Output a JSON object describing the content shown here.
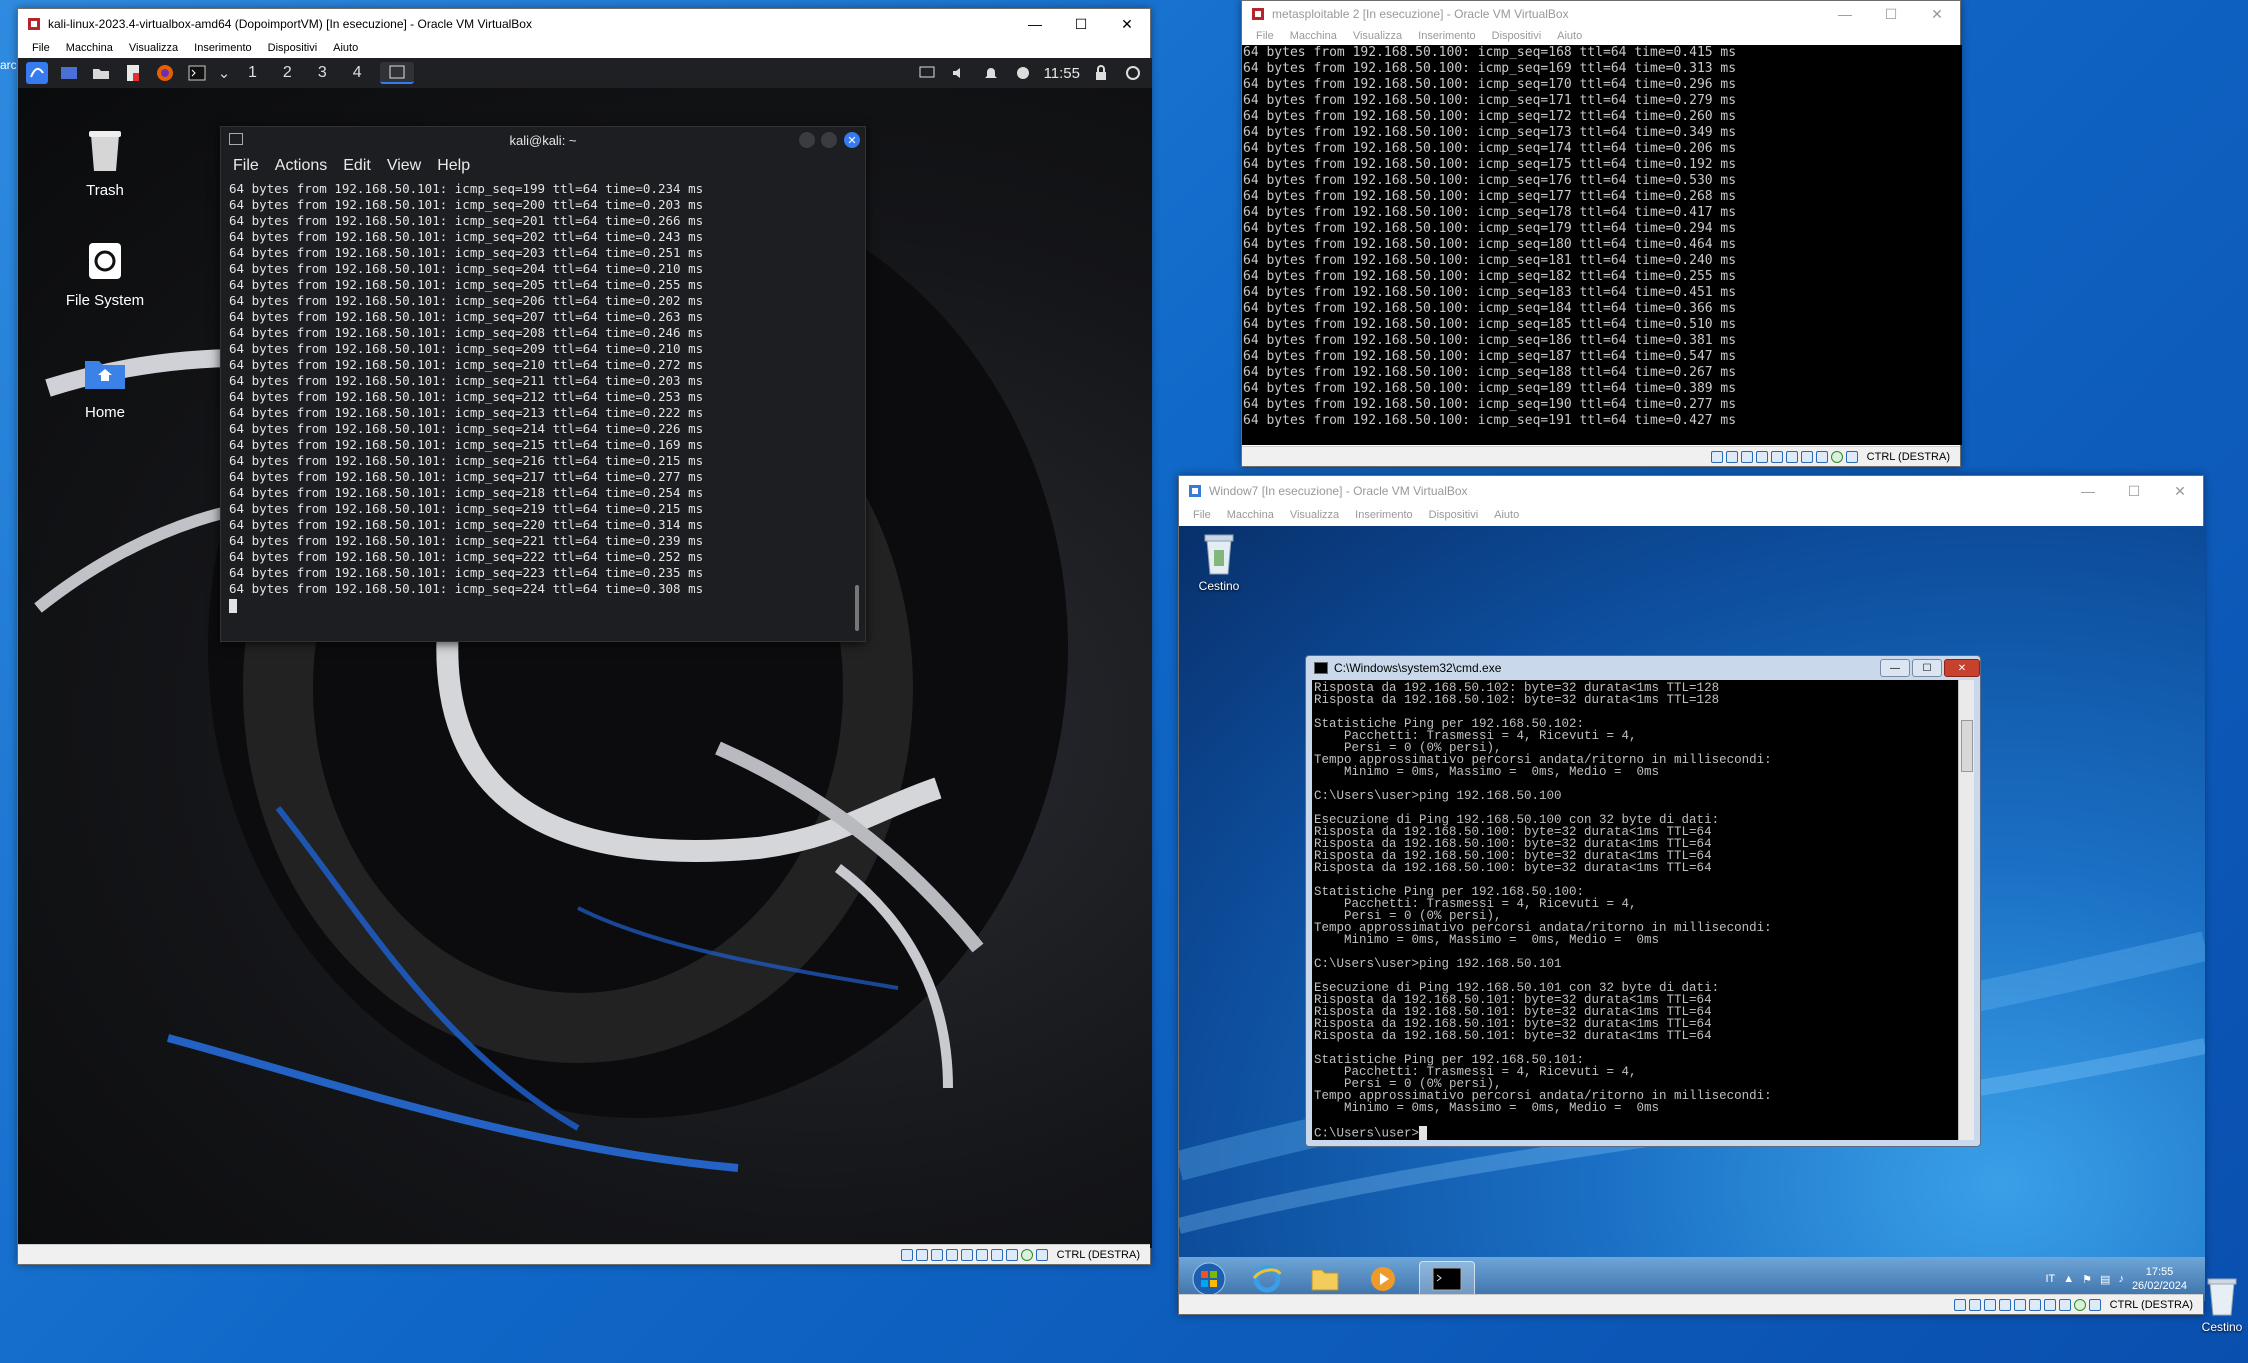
{
  "kali_window": {
    "title": "kali-linux-2023.4-virtualbox-amd64 (DopoimportVM) [In esecuzione] - Oracle VM VirtualBox",
    "menu": [
      "File",
      "Macchina",
      "Visualizza",
      "Inserimento",
      "Dispositivi",
      "Aiuto"
    ],
    "status_host_key": "CTRL (DESTRA)"
  },
  "kali_panel": {
    "workspaces": [
      "1",
      "2",
      "3",
      "4"
    ],
    "clock": "11:55"
  },
  "kali_desktop_icons": [
    "Trash",
    "File System",
    "Home"
  ],
  "terminal": {
    "title": "kali@kali: ~",
    "menu": [
      "File",
      "Actions",
      "Edit",
      "View",
      "Help"
    ],
    "lines": [
      "64 bytes from 192.168.50.101: icmp_seq=199 ttl=64 time=0.234 ms",
      "64 bytes from 192.168.50.101: icmp_seq=200 ttl=64 time=0.203 ms",
      "64 bytes from 192.168.50.101: icmp_seq=201 ttl=64 time=0.266 ms",
      "64 bytes from 192.168.50.101: icmp_seq=202 ttl=64 time=0.243 ms",
      "64 bytes from 192.168.50.101: icmp_seq=203 ttl=64 time=0.251 ms",
      "64 bytes from 192.168.50.101: icmp_seq=204 ttl=64 time=0.210 ms",
      "64 bytes from 192.168.50.101: icmp_seq=205 ttl=64 time=0.255 ms",
      "64 bytes from 192.168.50.101: icmp_seq=206 ttl=64 time=0.202 ms",
      "64 bytes from 192.168.50.101: icmp_seq=207 ttl=64 time=0.263 ms",
      "64 bytes from 192.168.50.101: icmp_seq=208 ttl=64 time=0.246 ms",
      "64 bytes from 192.168.50.101: icmp_seq=209 ttl=64 time=0.210 ms",
      "64 bytes from 192.168.50.101: icmp_seq=210 ttl=64 time=0.272 ms",
      "64 bytes from 192.168.50.101: icmp_seq=211 ttl=64 time=0.203 ms",
      "64 bytes from 192.168.50.101: icmp_seq=212 ttl=64 time=0.253 ms",
      "64 bytes from 192.168.50.101: icmp_seq=213 ttl=64 time=0.222 ms",
      "64 bytes from 192.168.50.101: icmp_seq=214 ttl=64 time=0.226 ms",
      "64 bytes from 192.168.50.101: icmp_seq=215 ttl=64 time=0.169 ms",
      "64 bytes from 192.168.50.101: icmp_seq=216 ttl=64 time=0.215 ms",
      "64 bytes from 192.168.50.101: icmp_seq=217 ttl=64 time=0.277 ms",
      "64 bytes from 192.168.50.101: icmp_seq=218 ttl=64 time=0.254 ms",
      "64 bytes from 192.168.50.101: icmp_seq=219 ttl=64 time=0.215 ms",
      "64 bytes from 192.168.50.101: icmp_seq=220 ttl=64 time=0.314 ms",
      "64 bytes from 192.168.50.101: icmp_seq=221 ttl=64 time=0.239 ms",
      "64 bytes from 192.168.50.101: icmp_seq=222 ttl=64 time=0.252 ms",
      "64 bytes from 192.168.50.101: icmp_seq=223 ttl=64 time=0.235 ms",
      "64 bytes from 192.168.50.101: icmp_seq=224 ttl=64 time=0.308 ms"
    ]
  },
  "meta_window": {
    "title": "metasploitable 2 [In esecuzione] - Oracle VM VirtualBox",
    "menu": [
      "File",
      "Macchina",
      "Visualizza",
      "Inserimento",
      "Dispositivi",
      "Aiuto"
    ],
    "status_host_key": "CTRL (DESTRA)",
    "lines": [
      "64 bytes from 192.168.50.100: icmp_seq=168 ttl=64 time=0.415 ms",
      "64 bytes from 192.168.50.100: icmp_seq=169 ttl=64 time=0.313 ms",
      "64 bytes from 192.168.50.100: icmp_seq=170 ttl=64 time=0.296 ms",
      "64 bytes from 192.168.50.100: icmp_seq=171 ttl=64 time=0.279 ms",
      "64 bytes from 192.168.50.100: icmp_seq=172 ttl=64 time=0.260 ms",
      "64 bytes from 192.168.50.100: icmp_seq=173 ttl=64 time=0.349 ms",
      "64 bytes from 192.168.50.100: icmp_seq=174 ttl=64 time=0.206 ms",
      "64 bytes from 192.168.50.100: icmp_seq=175 ttl=64 time=0.192 ms",
      "64 bytes from 192.168.50.100: icmp_seq=176 ttl=64 time=0.530 ms",
      "64 bytes from 192.168.50.100: icmp_seq=177 ttl=64 time=0.268 ms",
      "64 bytes from 192.168.50.100: icmp_seq=178 ttl=64 time=0.417 ms",
      "64 bytes from 192.168.50.100: icmp_seq=179 ttl=64 time=0.294 ms",
      "64 bytes from 192.168.50.100: icmp_seq=180 ttl=64 time=0.464 ms",
      "64 bytes from 192.168.50.100: icmp_seq=181 ttl=64 time=0.240 ms",
      "64 bytes from 192.168.50.100: icmp_seq=182 ttl=64 time=0.255 ms",
      "64 bytes from 192.168.50.100: icmp_seq=183 ttl=64 time=0.451 ms",
      "64 bytes from 192.168.50.100: icmp_seq=184 ttl=64 time=0.366 ms",
      "64 bytes from 192.168.50.100: icmp_seq=185 ttl=64 time=0.510 ms",
      "64 bytes from 192.168.50.100: icmp_seq=186 ttl=64 time=0.381 ms",
      "64 bytes from 192.168.50.100: icmp_seq=187 ttl=64 time=0.547 ms",
      "64 bytes from 192.168.50.100: icmp_seq=188 ttl=64 time=0.267 ms",
      "64 bytes from 192.168.50.100: icmp_seq=189 ttl=64 time=0.389 ms",
      "64 bytes from 192.168.50.100: icmp_seq=190 ttl=64 time=0.277 ms",
      "64 bytes from 192.168.50.100: icmp_seq=191 ttl=64 time=0.427 ms"
    ]
  },
  "win7_window": {
    "title": "Window7 [In esecuzione] - Oracle VM VirtualBox",
    "menu": [
      "File",
      "Macchina",
      "Visualizza",
      "Inserimento",
      "Dispositivi",
      "Aiuto"
    ],
    "status_host_key": "CTRL (DESTRA)",
    "desktop_icon": "Cestino",
    "taskbar": {
      "lang": "IT",
      "time": "17:55",
      "date": "26/02/2024"
    }
  },
  "cmd": {
    "title": "C:\\Windows\\system32\\cmd.exe",
    "lines": [
      "Risposta da 192.168.50.102: byte=32 durata<1ms TTL=128",
      "Risposta da 192.168.50.102: byte=32 durata<1ms TTL=128",
      "",
      "Statistiche Ping per 192.168.50.102:",
      "    Pacchetti: Trasmessi = 4, Ricevuti = 4,",
      "    Persi = 0 (0% persi),",
      "Tempo approssimativo percorsi andata/ritorno in millisecondi:",
      "    Minimo = 0ms, Massimo =  0ms, Medio =  0ms",
      "",
      "C:\\Users\\user>ping 192.168.50.100",
      "",
      "Esecuzione di Ping 192.168.50.100 con 32 byte di dati:",
      "Risposta da 192.168.50.100: byte=32 durata<1ms TTL=64",
      "Risposta da 192.168.50.100: byte=32 durata<1ms TTL=64",
      "Risposta da 192.168.50.100: byte=32 durata<1ms TTL=64",
      "Risposta da 192.168.50.100: byte=32 durata<1ms TTL=64",
      "",
      "Statistiche Ping per 192.168.50.100:",
      "    Pacchetti: Trasmessi = 4, Ricevuti = 4,",
      "    Persi = 0 (0% persi),",
      "Tempo approssimativo percorsi andata/ritorno in millisecondi:",
      "    Minimo = 0ms, Massimo =  0ms, Medio =  0ms",
      "",
      "C:\\Users\\user>ping 192.168.50.101",
      "",
      "Esecuzione di Ping 192.168.50.101 con 32 byte di dati:",
      "Risposta da 192.168.50.101: byte=32 durata<1ms TTL=64",
      "Risposta da 192.168.50.101: byte=32 durata<1ms TTL=64",
      "Risposta da 192.168.50.101: byte=32 durata<1ms TTL=64",
      "Risposta da 192.168.50.101: byte=32 durata<1ms TTL=64",
      "",
      "Statistiche Ping per 192.168.50.101:",
      "    Pacchetti: Trasmessi = 4, Ricevuti = 4,",
      "    Persi = 0 (0% persi),",
      "Tempo approssimativo percorsi andata/ritorno in millisecondi:",
      "    Minimo = 0ms, Massimo =  0ms, Medio =  0ms",
      "",
      "C:\\Users\\user>"
    ]
  },
  "host_desktop": {
    "recycle_bin": "Cestino",
    "corner_label": "arc"
  }
}
